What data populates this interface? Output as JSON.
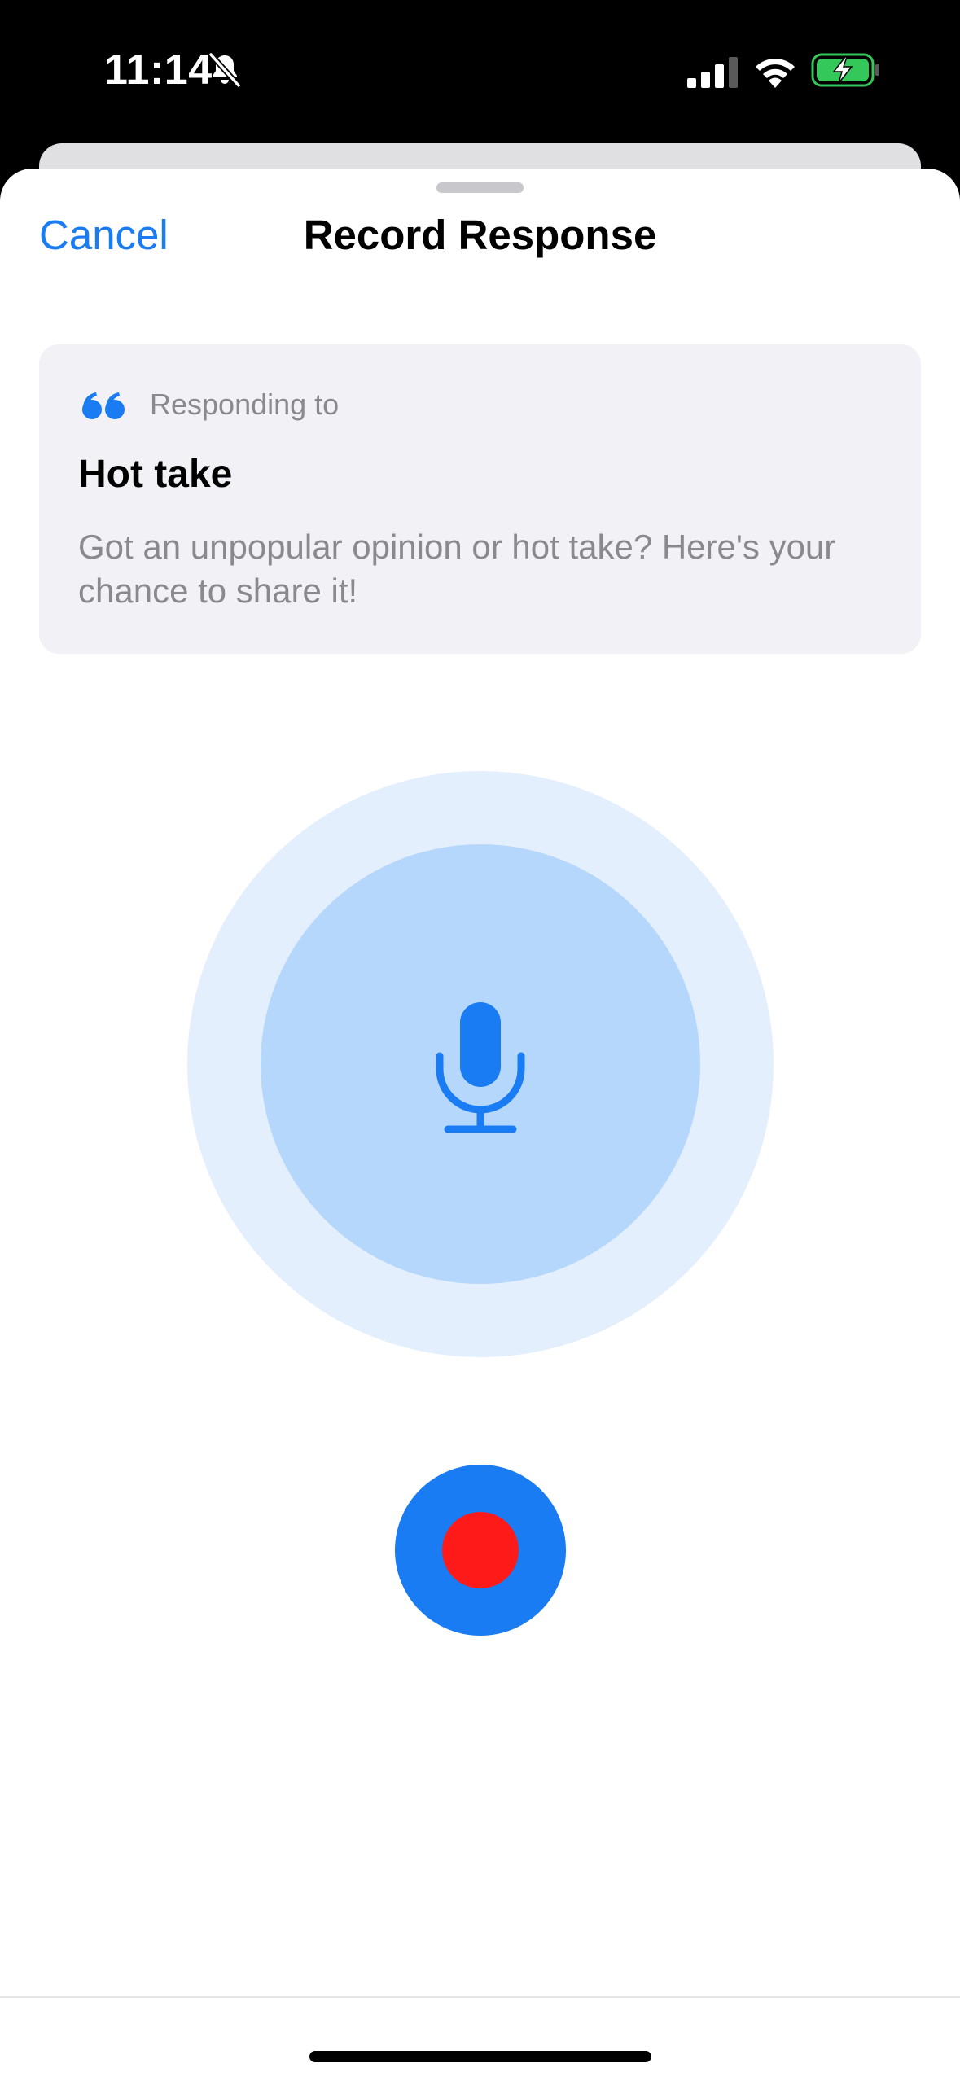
{
  "status_bar": {
    "time": "11:14",
    "icons": [
      "bell-slash-icon",
      "cellular-signal-icon",
      "wifi-icon",
      "battery-charging-icon"
    ],
    "battery_color": "#34c759"
  },
  "sheet": {
    "cancel_label": "Cancel",
    "title": "Record Response"
  },
  "prompt": {
    "icon": "quote-icon",
    "responding_label": "Responding to",
    "title": "Hot take",
    "description": "Got an unpopular opinion or hot take? Here's your chance to share it!"
  },
  "recorder": {
    "mic_icon": "microphone-icon",
    "record_icon": "record-dot-icon"
  },
  "colors": {
    "accent": "#1a7cf2",
    "record": "#ff1a1a",
    "card_bg": "#f1f1f6",
    "secondary_text": "#8a8a8e",
    "mic_outer": "#e4effd",
    "mic_inner": "#b6d7fc"
  }
}
